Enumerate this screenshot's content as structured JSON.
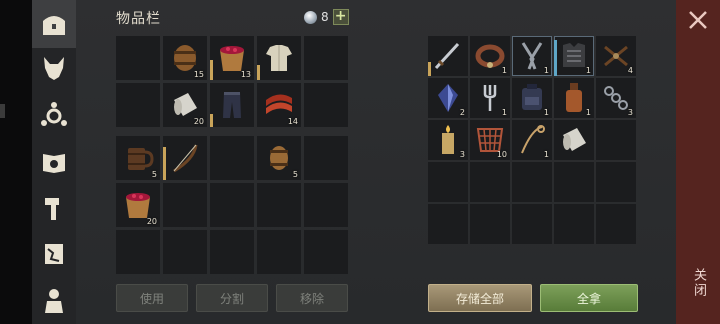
{
  "window": {
    "title": "物品栏",
    "currency_count": "8",
    "currency_add": "+"
  },
  "close": {
    "label": "关闭"
  },
  "sidebar": {
    "items": [
      {
        "name": "chest-icon",
        "active": true
      },
      {
        "name": "wolf-head-icon",
        "active": false
      },
      {
        "name": "hub-icon",
        "active": false
      },
      {
        "name": "recipe-book-icon",
        "active": false
      },
      {
        "name": "build-hammer-icon",
        "active": false
      },
      {
        "name": "map-scroll-icon",
        "active": false
      },
      {
        "name": "character-icon",
        "active": false
      }
    ]
  },
  "inventory": {
    "main_grid": [
      {
        "icon": "",
        "qty": ""
      },
      {
        "icon": "barrel",
        "qty": "15"
      },
      {
        "icon": "bucket-berries",
        "qty": "13",
        "bar": 0.45
      },
      {
        "icon": "shirt",
        "qty": "",
        "bar": 0.35
      },
      {
        "icon": "",
        "qty": ""
      },
      {
        "icon": "",
        "qty": ""
      },
      {
        "icon": "cloth-roll",
        "qty": "20"
      },
      {
        "icon": "pants",
        "qty": "",
        "bar": 0.3
      },
      {
        "icon": "meat-strips",
        "qty": "14"
      },
      {
        "icon": "",
        "qty": ""
      }
    ],
    "quick_grid": [
      {
        "icon": "mug",
        "qty": "5"
      },
      {
        "icon": "bow",
        "qty": "",
        "bar": 0.75
      },
      {
        "icon": "",
        "qty": ""
      },
      {
        "icon": "barrel-small",
        "qty": "5"
      },
      {
        "icon": "",
        "qty": ""
      },
      {
        "icon": "bucket-berries",
        "qty": "20"
      },
      {
        "icon": "",
        "qty": ""
      },
      {
        "icon": "",
        "qty": ""
      },
      {
        "icon": "",
        "qty": ""
      },
      {
        "icon": "",
        "qty": ""
      },
      {
        "icon": "",
        "qty": ""
      },
      {
        "icon": "",
        "qty": ""
      },
      {
        "icon": "",
        "qty": ""
      },
      {
        "icon": "",
        "qty": ""
      },
      {
        "icon": "",
        "qty": ""
      }
    ],
    "buttons": {
      "use": "使用",
      "split": "分割",
      "remove": "移除"
    }
  },
  "storage": {
    "grid": [
      {
        "icon": "sword",
        "qty": "",
        "bar": 0.35
      },
      {
        "icon": "collar",
        "qty": "1"
      },
      {
        "icon": "tongs",
        "qty": "1",
        "sel": true
      },
      {
        "icon": "armor",
        "qty": "1",
        "bar": 0.9,
        "blue": true,
        "sel": true
      },
      {
        "icon": "crossbow-parts",
        "qty": "4"
      },
      {
        "icon": "crystal",
        "qty": "2"
      },
      {
        "icon": "fork",
        "qty": "1"
      },
      {
        "icon": "backpack",
        "qty": "1"
      },
      {
        "icon": "bottle",
        "qty": "1"
      },
      {
        "icon": "chain",
        "qty": "3"
      },
      {
        "icon": "candle",
        "qty": "3"
      },
      {
        "icon": "net",
        "qty": "10"
      },
      {
        "icon": "rope",
        "qty": "1"
      },
      {
        "icon": "cloth-roll",
        "qty": ""
      },
      {
        "icon": "",
        "qty": ""
      },
      {
        "icon": "",
        "qty": ""
      },
      {
        "icon": "",
        "qty": ""
      },
      {
        "icon": "",
        "qty": ""
      },
      {
        "icon": "",
        "qty": ""
      },
      {
        "icon": "",
        "qty": ""
      },
      {
        "icon": "",
        "qty": ""
      },
      {
        "icon": "",
        "qty": ""
      },
      {
        "icon": "",
        "qty": ""
      },
      {
        "icon": "",
        "qty": ""
      },
      {
        "icon": "",
        "qty": ""
      }
    ],
    "buttons": {
      "store_all": "存储全部",
      "take_all": "全拿"
    }
  },
  "colors": {
    "accent_green": "#6f9447",
    "close_red": "#55241f",
    "durability": "#c9a45a"
  }
}
